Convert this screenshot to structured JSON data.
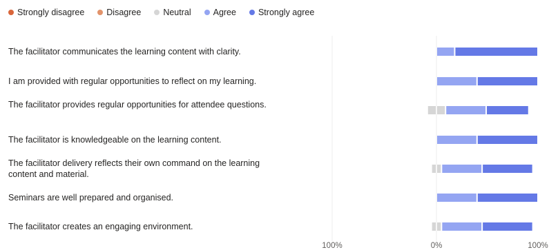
{
  "colors": {
    "strongly_disagree": "#d9663b",
    "disagree": "#e2936b",
    "neutral": "#d6d6d6",
    "agree": "#94a5f2",
    "strongly_agree": "#6479e6"
  },
  "legend": [
    {
      "label": "Strongly disagree",
      "color": "#d9663b"
    },
    {
      "label": "Disagree",
      "color": "#e2936b"
    },
    {
      "label": "Neutral",
      "color": "#d6d6d6"
    },
    {
      "label": "Agree",
      "color": "#94a5f2"
    },
    {
      "label": "Strongly agree",
      "color": "#6479e6"
    }
  ],
  "questions": [
    "The facilitator communicates the learning content with clarity.",
    "I am provided with regular opportunities to reflect on my learning.",
    "The facilitator provides regular opportunities for attendee questions.",
    "The facilitator is knowledgeable on the learning content.",
    "The facilitator delivery reflects their own command on the learning content and material.",
    "Seminars are well prepared and organised.",
    "The facilitator creates an engaging environment."
  ],
  "chart_data": {
    "type": "bar",
    "subtype": "diverging-stacked-horizontal",
    "categories": [
      "The facilitator communicates the learning content with clarity.",
      "I am provided with regular opportunities to reflect on my learning.",
      "The facilitator provides regular opportunities for attendee questions.",
      "The facilitator is knowledgeable on the learning content.",
      "The facilitator delivery reflects their own command on the learning content and material.",
      "Seminars are well prepared and organised.",
      "The facilitator creates an engaging environment."
    ],
    "series": [
      {
        "name": "Strongly disagree",
        "values": [
          0,
          0,
          0,
          0,
          0,
          0,
          0
        ]
      },
      {
        "name": "Disagree",
        "values": [
          0,
          0,
          0,
          0,
          0,
          0,
          0
        ]
      },
      {
        "name": "Neutral",
        "values": [
          0,
          0,
          18,
          0,
          10,
          0,
          10
        ]
      },
      {
        "name": "Agree",
        "values": [
          18,
          40,
          40,
          40,
          40,
          40,
          40
        ]
      },
      {
        "name": "Strongly agree",
        "values": [
          82,
          60,
          42,
          60,
          50,
          60,
          50
        ]
      }
    ],
    "xlim": [
      -100,
      100
    ],
    "x_ticks": [
      "100%",
      "0%",
      "100%"
    ],
    "legend_position": "top-left",
    "grid": true
  }
}
